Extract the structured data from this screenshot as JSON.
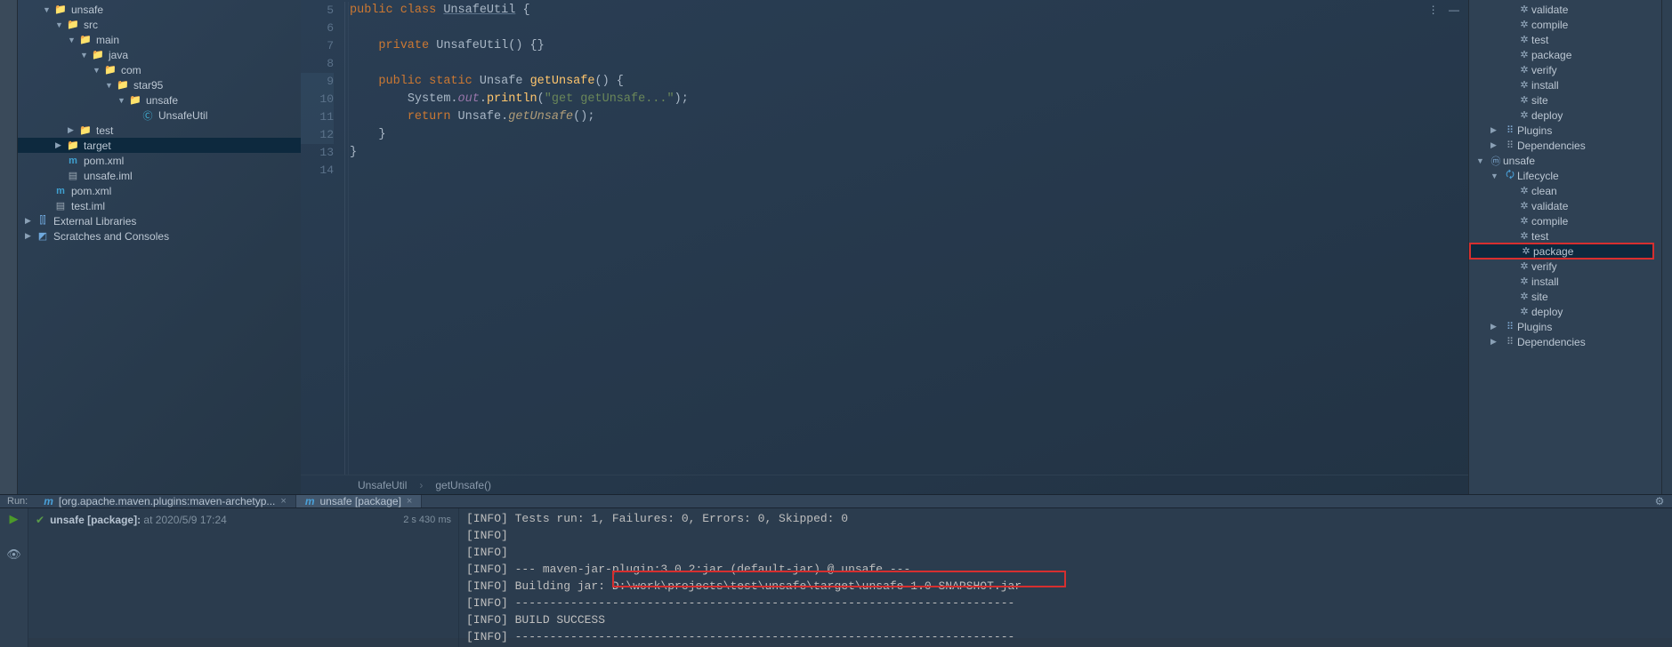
{
  "project": {
    "root": "unsafe",
    "tree": [
      {
        "depth": 0,
        "arrow": "▼",
        "icon": "folder-src",
        "label": "unsafe"
      },
      {
        "depth": 1,
        "arrow": "▼",
        "icon": "folder",
        "label": "src"
      },
      {
        "depth": 2,
        "arrow": "▼",
        "icon": "folder",
        "label": "main"
      },
      {
        "depth": 3,
        "arrow": "▼",
        "icon": "folder-src",
        "label": "java"
      },
      {
        "depth": 4,
        "arrow": "▼",
        "icon": "folder",
        "label": "com"
      },
      {
        "depth": 5,
        "arrow": "▼",
        "icon": "folder",
        "label": "star95"
      },
      {
        "depth": 6,
        "arrow": "▼",
        "icon": "folder",
        "label": "unsafe"
      },
      {
        "depth": 7,
        "arrow": "",
        "icon": "class",
        "label": "UnsafeUtil"
      },
      {
        "depth": 2,
        "arrow": "▶",
        "icon": "folder",
        "label": "test"
      },
      {
        "depth": 1,
        "arrow": "▶",
        "icon": "folder-excl",
        "label": "target",
        "selected": true
      },
      {
        "depth": 1,
        "arrow": "",
        "icon": "maven",
        "label": "pom.xml"
      },
      {
        "depth": 1,
        "arrow": "",
        "icon": "iml",
        "label": "unsafe.iml"
      },
      {
        "depth": 0,
        "arrow": "",
        "icon": "maven",
        "label": "pom.xml"
      },
      {
        "depth": 0,
        "arrow": "",
        "icon": "iml",
        "label": "test.iml"
      },
      {
        "depth": -1,
        "arrow": "▶",
        "icon": "lib",
        "label": "External Libraries"
      },
      {
        "depth": -1,
        "arrow": "▶",
        "icon": "scratch",
        "label": "Scratches and Consoles"
      }
    ]
  },
  "editor": {
    "lines": [
      "5",
      "6",
      "7",
      "8",
      "9",
      "10",
      "11",
      "12",
      "13",
      "14"
    ],
    "breadcrumb": [
      "UnsafeUtil",
      "getUnsafe()"
    ],
    "code": {
      "l5": {
        "kw": "public class",
        "cls": "UnsafeUtil",
        "br": " {"
      },
      "l7": {
        "kw": "private",
        "name": "UnsafeUtil",
        "tail": "() {}"
      },
      "l9": {
        "kw1": "public",
        "kw2": "static",
        "type": "Unsafe",
        "method": "getUnsafe",
        "tail": "() {"
      },
      "l10": {
        "pre": "System.",
        "field": "out",
        "dot": ".",
        "method": "println",
        "open": "(",
        "str": "\"get getUnsafe...\"",
        "close": ");"
      },
      "l11": {
        "kw": "return",
        "pre": " Unsafe.",
        "method": "getUnsafe",
        "tail": "();"
      },
      "l12": "}",
      "l13": "}"
    }
  },
  "maven": {
    "items": [
      {
        "depth": 2,
        "type": "goal",
        "label": "validate"
      },
      {
        "depth": 2,
        "type": "goal",
        "label": "compile"
      },
      {
        "depth": 2,
        "type": "goal",
        "label": "test"
      },
      {
        "depth": 2,
        "type": "goal",
        "label": "package"
      },
      {
        "depth": 2,
        "type": "goal",
        "label": "verify"
      },
      {
        "depth": 2,
        "type": "goal",
        "label": "install"
      },
      {
        "depth": 2,
        "type": "goal",
        "label": "site"
      },
      {
        "depth": 2,
        "type": "goal",
        "label": "deploy"
      },
      {
        "depth": 1,
        "type": "plugins",
        "arrow": "▶",
        "label": "Plugins"
      },
      {
        "depth": 1,
        "type": "deps",
        "arrow": "▶",
        "label": "Dependencies"
      },
      {
        "depth": 0,
        "type": "module",
        "arrow": "▼",
        "label": "unsafe"
      },
      {
        "depth": 1,
        "type": "lifecycle",
        "arrow": "▼",
        "label": "Lifecycle"
      },
      {
        "depth": 2,
        "type": "goal",
        "label": "clean"
      },
      {
        "depth": 2,
        "type": "goal",
        "label": "validate"
      },
      {
        "depth": 2,
        "type": "goal",
        "label": "compile"
      },
      {
        "depth": 2,
        "type": "goal",
        "label": "test"
      },
      {
        "depth": 2,
        "type": "goal",
        "label": "package",
        "selected": true,
        "boxed": true
      },
      {
        "depth": 2,
        "type": "goal",
        "label": "verify"
      },
      {
        "depth": 2,
        "type": "goal",
        "label": "install"
      },
      {
        "depth": 2,
        "type": "goal",
        "label": "site"
      },
      {
        "depth": 2,
        "type": "goal",
        "label": "deploy"
      },
      {
        "depth": 1,
        "type": "plugins",
        "arrow": "▶",
        "label": "Plugins"
      },
      {
        "depth": 1,
        "type": "deps",
        "arrow": "▶",
        "label": "Dependencies"
      }
    ]
  },
  "run": {
    "label": "Run:",
    "tabs": [
      {
        "label": "[org.apache.maven.plugins:maven-archetyp...",
        "active": false
      },
      {
        "label": "unsafe [package]",
        "active": true
      }
    ],
    "tree": {
      "title": "unsafe [package]:",
      "at": " at 2020/5/9 17:24",
      "dur": "2 s 430 ms"
    },
    "console_raw": "[INFO] Tests run: 1, Failures: 0, Errors: 0, Skipped: 0\n[INFO]\n[INFO]\n[INFO] --- maven-jar-plugin:3.0.2:jar (default-jar) @ unsafe ---\n[INFO] Building jar: D:\\work\\projects\\test\\unsafe\\target\\unsafe-1.0-SNAPSHOT.jar\n[INFO] ------------------------------------------------------------------------\n[INFO] BUILD SUCCESS\n[INFO] ------------------------------------------------------------------------"
  }
}
